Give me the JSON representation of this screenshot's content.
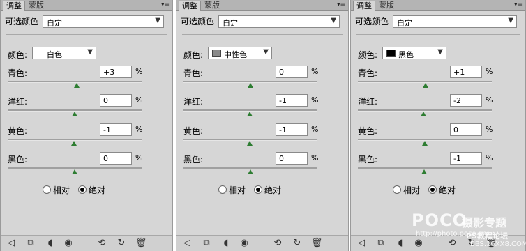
{
  "panels": [
    {
      "tab_active": "调整",
      "tab_inactive": "蒙版",
      "menu_icon": "panel-menu-icon",
      "preset_label": "可选颜色",
      "preset_value": "自定",
      "color_label": "颜色:",
      "color_value": "白色",
      "swatch": null,
      "rows": [
        {
          "label": "青色:",
          "value": "+3",
          "level": 3
        },
        {
          "label": "洋红:",
          "value": "0",
          "level": 0
        },
        {
          "label": "黄色:",
          "value": "-1",
          "level": -1
        },
        {
          "label": "黑色:",
          "value": "0",
          "level": 0
        }
      ],
      "pct": "%",
      "radio_relative": "相对",
      "radio_absolute": "绝对",
      "radio_selected": "absolute"
    },
    {
      "tab_active": "调整",
      "tab_inactive": "蒙版",
      "menu_icon": "panel-menu-icon",
      "preset_label": "可选颜色",
      "preset_value": "自定",
      "color_label": "颜色:",
      "color_value": "中性色",
      "swatch": "#8a8a8a",
      "rows": [
        {
          "label": "青色:",
          "value": "0",
          "level": 0
        },
        {
          "label": "洋红:",
          "value": "-1",
          "level": -1
        },
        {
          "label": "黄色:",
          "value": "-1",
          "level": -1
        },
        {
          "label": "黑色:",
          "value": "0",
          "level": 0
        }
      ],
      "pct": "%",
      "radio_relative": "相对",
      "radio_absolute": "绝对",
      "radio_selected": "absolute"
    },
    {
      "tab_active": "调整",
      "tab_inactive": "蒙版",
      "menu_icon": "panel-menu-icon",
      "preset_label": "可选颜色",
      "preset_value": "自定",
      "color_label": "颜色:",
      "color_value": "黑色",
      "swatch": "#000000",
      "rows": [
        {
          "label": "青色:",
          "value": "+1",
          "level": 1
        },
        {
          "label": "洋红:",
          "value": "-2",
          "level": -2
        },
        {
          "label": "黄色:",
          "value": "0",
          "level": 0
        },
        {
          "label": "黑色:",
          "value": "-1",
          "level": -1
        }
      ],
      "pct": "%",
      "radio_relative": "相对",
      "radio_absolute": "绝对",
      "radio_selected": "absolute"
    }
  ],
  "bottom_icons": [
    "back-arrow-icon",
    "clip-to-layer-icon",
    "visibility-mask-icon",
    "eye-icon",
    "previous-state-icon",
    "reset-icon",
    "trash-icon"
  ],
  "watermark": {
    "logo": "POCO",
    "title": "摄影专题",
    "url": "http://photo.poco.cn/",
    "forum": "PS教程论坛",
    "site": "BBS.16XX8.COM"
  },
  "colors": {
    "panel_bg": "#d6d6d6",
    "thumb": "#2e7d32"
  }
}
